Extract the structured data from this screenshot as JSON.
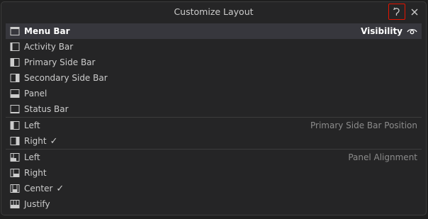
{
  "dialog": {
    "title": "Customize Layout",
    "reset_icon": "reset-icon",
    "close_icon": "close-icon"
  },
  "visibility_group": {
    "label": "Visibility",
    "label_icon": "eye-icon",
    "items": [
      {
        "label": "Menu Bar",
        "icon": "menu-bar-icon"
      },
      {
        "label": "Activity Bar",
        "icon": "activity-bar-icon"
      },
      {
        "label": "Primary Side Bar",
        "icon": "primary-side-bar-icon"
      },
      {
        "label": "Secondary Side Bar",
        "icon": "secondary-side-bar-icon"
      },
      {
        "label": "Panel",
        "icon": "panel-icon"
      },
      {
        "label": "Status Bar",
        "icon": "status-bar-icon"
      }
    ]
  },
  "side_bar_position_group": {
    "label": "Primary Side Bar Position",
    "items": [
      {
        "label": "Left",
        "icon": "side-bar-left-icon",
        "check": ""
      },
      {
        "label": "Right",
        "icon": "side-bar-right-icon",
        "check": "✓"
      }
    ]
  },
  "panel_alignment_group": {
    "label": "Panel Alignment",
    "items": [
      {
        "label": "Left",
        "icon": "panel-align-left-icon",
        "check": ""
      },
      {
        "label": "Right",
        "icon": "panel-align-right-icon",
        "check": ""
      },
      {
        "label": "Center",
        "icon": "panel-align-center-icon",
        "check": "✓"
      },
      {
        "label": "Justify",
        "icon": "panel-align-justify-icon",
        "check": ""
      }
    ]
  },
  "colors": {
    "background": "#252526",
    "selected_row": "#37373d",
    "reset_highlight": "#e51400",
    "group_label": "#8b8b8b"
  }
}
